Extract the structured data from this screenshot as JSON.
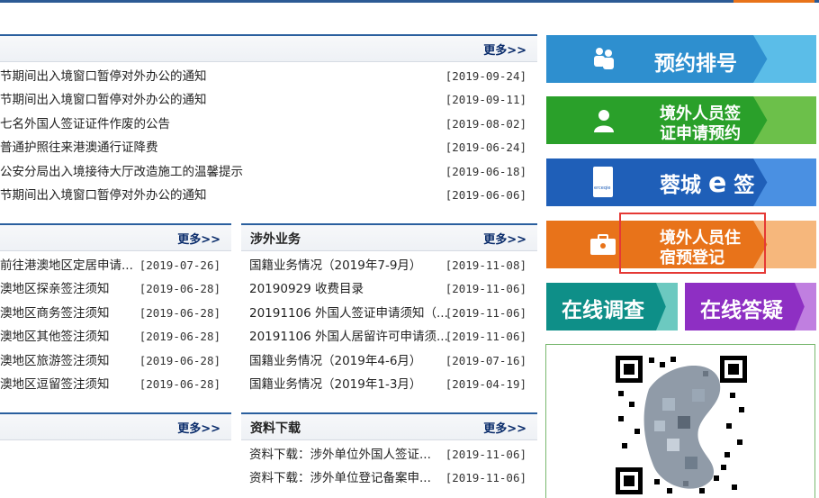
{
  "top_strip": {
    "accent_color": "#e8731a",
    "primary_color": "#2c5a94"
  },
  "notices": {
    "more": "更多>>",
    "items": [
      {
        "title": "节期间出入境窗口暂停对外办公的通知",
        "date": "[2019-09-24]"
      },
      {
        "title": "节期间出入境窗口暂停对外办公的通知",
        "date": "[2019-09-11]"
      },
      {
        "title": "七名外国人签证证件作废的公告",
        "date": "[2019-08-02]"
      },
      {
        "title": "普通护照往来港澳通行证降费",
        "date": "[2019-06-24]"
      },
      {
        "title": "公安分局出入境接待大厅改造施工的温馨提示",
        "date": "[2019-06-18]"
      },
      {
        "title": "节期间出入境窗口暂停对外办公的通知",
        "date": "[2019-06-06]"
      }
    ]
  },
  "hk_macau": {
    "more": "更多>>",
    "items": [
      {
        "title": "前往港澳地区定居申请...",
        "date": "[2019-07-26]"
      },
      {
        "title": "澳地区探亲签注须知",
        "date": "[2019-06-28]"
      },
      {
        "title": "澳地区商务签注须知",
        "date": "[2019-06-28]"
      },
      {
        "title": "澳地区其他签注须知",
        "date": "[2019-06-28]"
      },
      {
        "title": "澳地区旅游签注须知",
        "date": "[2019-06-28]"
      },
      {
        "title": "澳地区逗留签注须知",
        "date": "[2019-06-28]"
      }
    ]
  },
  "foreign_affairs": {
    "title": "涉外业务",
    "more": "更多>>",
    "items": [
      {
        "title": "国籍业务情况（2019年7-9月）",
        "date": "[2019-11-08]"
      },
      {
        "title": "20190929 收费目录",
        "date": "[2019-11-06]"
      },
      {
        "title": "20191106 外国人签证申请须知（...",
        "date": "[2019-11-06]"
      },
      {
        "title": "20191106 外国人居留许可申请须...",
        "date": "[2019-11-06]"
      },
      {
        "title": "国籍业务情况（2019年4-6月）",
        "date": "[2019-07-16]"
      },
      {
        "title": "国籍业务情况（2019年1-3月）",
        "date": "[2019-04-19]"
      }
    ]
  },
  "bottom_left": {
    "more": "更多>>"
  },
  "downloads": {
    "title": "资料下载",
    "more": "更多>>",
    "items": [
      {
        "title": "资料下载：涉外单位外国人签证...",
        "date": "[2019-11-06]"
      },
      {
        "title": "资料下载：涉外单位登记备案申...",
        "date": "[2019-11-06]"
      }
    ]
  },
  "tiles": {
    "appointment": {
      "label": "预约排号",
      "icon": "people-icon",
      "color": "#2e8fcf",
      "accent": "#5bbde8"
    },
    "visa": {
      "line1": "境外人员签",
      "line2": "证申请预约",
      "icon": "person-icon",
      "color": "#2aa02a",
      "accent": "#6cc04a"
    },
    "rongcheng": {
      "label_prefix": "蓉城",
      "label_e": "e",
      "label_suffix": "签",
      "icon_text": "erceqie",
      "color": "#1f5fb8",
      "accent": "#4a90e2"
    },
    "lodging": {
      "line1": "境外人员住",
      "line2": "宿预登记",
      "icon": "briefcase-icon",
      "color": "#e8731a",
      "accent": "#f6b77c",
      "highlight": "#e53935"
    },
    "survey": {
      "label": "在线调查",
      "color": "#0e8f88",
      "accent": "#6cc9c0"
    },
    "qa": {
      "label": "在线答疑",
      "color": "#8e2fc3",
      "accent": "#c07fe0"
    }
  },
  "qr": {
    "icon": "qr-code-icon",
    "border_color": "#79b86f"
  }
}
